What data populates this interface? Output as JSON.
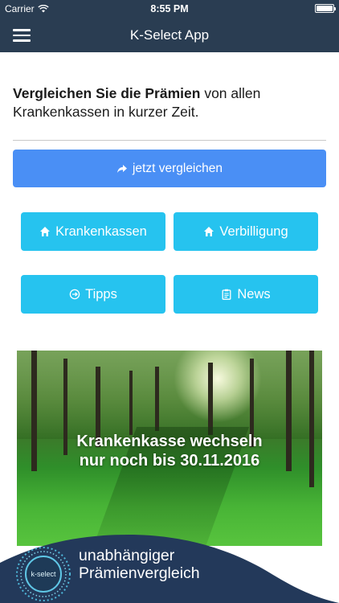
{
  "status_bar": {
    "carrier": "Carrier",
    "time": "8:55 PM",
    "wifi_icon": "wifi-icon",
    "battery_icon": "battery-icon"
  },
  "nav": {
    "title": "K-Select App",
    "menu_icon": "hamburger-menu-icon"
  },
  "intro": {
    "bold": "Vergleichen Sie die Prämien",
    "rest": " von allen Krankenkassen in kurzer Zeit."
  },
  "buttons": {
    "compare": {
      "label": "jetzt vergleichen",
      "icon": "share-arrow-icon"
    },
    "krankenkassen": {
      "label": "Krankenkassen",
      "icon": "home-icon"
    },
    "verbilligung": {
      "label": "Verbilligung",
      "icon": "home-icon"
    },
    "tipps": {
      "label": "Tipps",
      "icon": "arrow-circle-icon"
    },
    "news": {
      "label": "News",
      "icon": "clipboard-icon"
    }
  },
  "banner": {
    "line1": "Krankenkasse wechseln",
    "line2": "nur noch bis 30.11.2016"
  },
  "footer": {
    "logo_text": "k-select",
    "line1": "unabhängiger",
    "line2": "Prämienvergleich"
  },
  "colors": {
    "header": "#2a3d52",
    "primary_button": "#4a8ff5",
    "secondary_button": "#26c3ef"
  }
}
